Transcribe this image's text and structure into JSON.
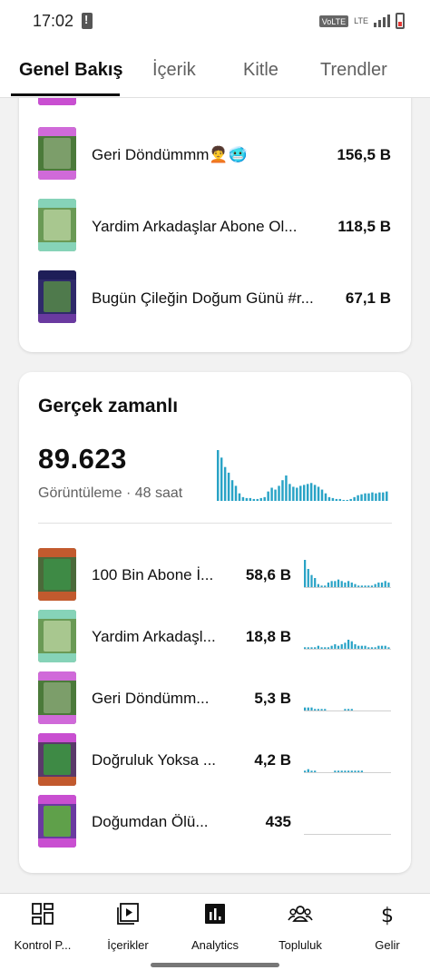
{
  "status_bar": {
    "time": "17:02",
    "volte": "VoLTE",
    "lte": "LTE"
  },
  "tabs": [
    {
      "label": "Genel Bakış",
      "active": true
    },
    {
      "label": "İçerik",
      "active": false
    },
    {
      "label": "Kitle",
      "active": false
    },
    {
      "label": "Trendler",
      "active": false
    }
  ],
  "top_videos": [
    {
      "title": "Geri Döndümmm🧑‍🦱🥶",
      "value": "156,5 B"
    },
    {
      "title": "Yardim Arkadaşlar Abone Ol...",
      "value": "118,5 B"
    },
    {
      "title": "Bugün Çileğin Doğum Günü #r...",
      "value": "67,1 B"
    }
  ],
  "realtime": {
    "heading": "Gerçek zamanlı",
    "total": "89.623",
    "subtitle": "Görüntüleme · 48 saat",
    "hourly_views": [
      54,
      46,
      36,
      30,
      22,
      16,
      8,
      4,
      3,
      3,
      2,
      2,
      3,
      4,
      10,
      14,
      12,
      16,
      22,
      27,
      18,
      15,
      14,
      16,
      17,
      18,
      19,
      17,
      15,
      12,
      8,
      4,
      3,
      2,
      2,
      1,
      1,
      2,
      4,
      6,
      7,
      8,
      8,
      9,
      8,
      9,
      9,
      10
    ],
    "videos": [
      {
        "title": "100 Bin Abone İ...",
        "value": "58,6 B",
        "spark": [
          18,
          12,
          8,
          6,
          2,
          1,
          1,
          3,
          4,
          4,
          5,
          4,
          3,
          4,
          3,
          2,
          1,
          1,
          1,
          1,
          1,
          2,
          3,
          3,
          4,
          3
        ]
      },
      {
        "title": "Yardim Arkadaşl...",
        "value": "18,8 B",
        "spark": [
          1,
          1,
          1,
          1,
          2,
          1,
          1,
          1,
          2,
          3,
          2,
          3,
          4,
          6,
          5,
          3,
          2,
          2,
          2,
          1,
          1,
          1,
          2,
          2,
          2,
          1
        ]
      },
      {
        "title": "Geri Döndümm...",
        "value": "5,3 B",
        "spark": [
          2,
          2,
          2,
          1,
          1,
          1,
          1,
          0,
          0,
          0,
          0,
          0,
          1,
          1,
          1,
          0,
          0,
          0,
          0,
          0,
          0,
          0,
          0,
          0,
          0,
          0
        ]
      },
      {
        "title": "Doğruluk Yoksa ...",
        "value": "4,2 B",
        "spark": [
          1,
          2,
          1,
          1,
          0,
          0,
          0,
          0,
          0,
          1,
          1,
          1,
          1,
          1,
          1,
          1,
          1,
          1,
          0,
          0,
          0,
          0,
          0,
          0,
          0,
          0
        ]
      },
      {
        "title": "Doğumdan Ölü...",
        "value": "435",
        "spark": [
          0,
          0,
          0,
          0,
          0,
          0,
          0,
          0,
          0,
          0,
          0,
          0,
          0,
          0,
          0,
          0,
          0,
          0,
          0,
          0,
          0,
          0,
          0,
          0,
          0,
          0
        ]
      }
    ]
  },
  "bottom_nav": [
    {
      "label": "Kontrol P...",
      "icon": "dashboard-icon"
    },
    {
      "label": "İçerikler",
      "icon": "content-icon"
    },
    {
      "label": "Analytics",
      "icon": "analytics-icon"
    },
    {
      "label": "Topluluk",
      "icon": "community-icon"
    },
    {
      "label": "Gelir",
      "icon": "earn-icon"
    }
  ],
  "colors": {
    "chart": "#29a3c6",
    "text": "#0f0f0f",
    "secondary": "#606060"
  }
}
